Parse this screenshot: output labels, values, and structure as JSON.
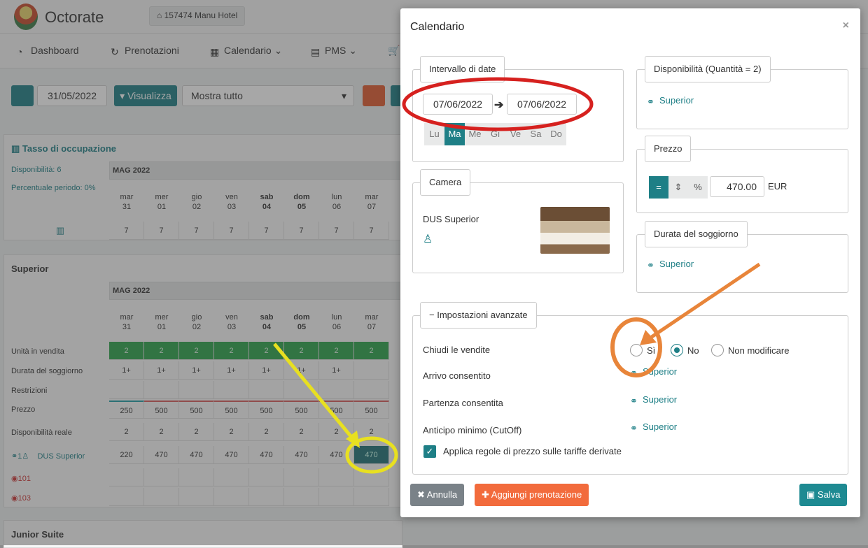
{
  "app": {
    "name": "Octorate",
    "hotel": "157474  Manu Hotel"
  },
  "nav": [
    {
      "label": "Dashboard",
      "icon": "dashboard-icon"
    },
    {
      "label": "Prenotazioni",
      "icon": "bookings-icon"
    },
    {
      "label": "Calendario",
      "icon": "calendar-icon"
    },
    {
      "label": "PMS",
      "icon": "pms-icon"
    }
  ],
  "toolbar": {
    "date": "31/05/2022",
    "visualizza": "Visualizza",
    "filter": "Mostra tutto"
  },
  "occupancy": {
    "title": "Tasso di occupazione",
    "disponibilita": "Disponibilità: 6",
    "percentuale": "Percentuale periodo: 0%",
    "month": "MAG 2022",
    "days": [
      {
        "d": "mar",
        "n": "31"
      },
      {
        "d": "mer",
        "n": "01"
      },
      {
        "d": "gio",
        "n": "02"
      },
      {
        "d": "ven",
        "n": "03"
      },
      {
        "d": "sab",
        "n": "04"
      },
      {
        "d": "dom",
        "n": "05"
      },
      {
        "d": "lun",
        "n": "06"
      },
      {
        "d": "mar",
        "n": "07"
      }
    ],
    "values": [
      "7",
      "7",
      "7",
      "7",
      "7",
      "7",
      "7",
      "7"
    ]
  },
  "superior": {
    "title": "Superior",
    "month": "MAG 2022",
    "rows": {
      "unita": {
        "label": "Unità in vendita",
        "values": [
          "2",
          "2",
          "2",
          "2",
          "2",
          "2",
          "2",
          "2"
        ]
      },
      "durata": {
        "label": "Durata del soggiorno",
        "values": [
          "1+",
          "1+",
          "1+",
          "1+",
          "1+",
          "1+",
          "1+",
          ""
        ]
      },
      "restrizioni": {
        "label": "Restrizioni"
      },
      "prezzo": {
        "label": "Prezzo",
        "values": [
          "250",
          "500",
          "500",
          "500",
          "500",
          "500",
          "500",
          "500"
        ]
      },
      "disp": {
        "label": "Disponibilità reale",
        "values": [
          "2",
          "2",
          "2",
          "2",
          "2",
          "2",
          "2",
          "2"
        ]
      },
      "dus": {
        "label": "DUS Superior",
        "prefix": "1",
        "values": [
          "220",
          "470",
          "470",
          "470",
          "470",
          "470",
          "470",
          "470"
        ]
      }
    },
    "rooms": [
      "101",
      "103"
    ]
  },
  "junior": {
    "title": "Junior Suite"
  },
  "modal": {
    "title": "Calendario",
    "close": "×",
    "intervallo": {
      "legend": "Intervallo di date",
      "from": "07/06/2022",
      "to": "07/06/2022",
      "days": [
        "Lu",
        "Ma",
        "Me",
        "Gi",
        "Ve",
        "Sa",
        "Do"
      ]
    },
    "disponibilita": {
      "legend": "Disponibilità (Quantità = 2)",
      "link": "Superior"
    },
    "prezzo": {
      "legend": "Prezzo",
      "value": "470.00",
      "currency": "EUR",
      "eq": "=",
      "updown": "⇕",
      "pct": "%"
    },
    "camera": {
      "legend": "Camera",
      "name": "DUS Superior"
    },
    "durata": {
      "legend": "Durata del soggiorno",
      "link": "Superior"
    },
    "avanzate": {
      "legend": "Impostazioni avanzate",
      "chiudi": "Chiudi le vendite",
      "opt_si": "Sì",
      "opt_no": "No",
      "opt_nonmod": "Non modificare",
      "arrivo": "Arrivo consentito",
      "arrivo_link": "Superior",
      "partenza": "Partenza consentita",
      "partenza_link": "Superior",
      "anticipo": "Anticipo minimo (CutOff)",
      "anticipo_link": "Superior",
      "applica": "Applica regole di prezzo sulle tariffe derivate"
    },
    "buttons": {
      "annulla": "Annulla",
      "aggiungi": "Aggiungi prenotazione",
      "salva": "Salva"
    }
  },
  "colors": {
    "teal": "#1e7f86",
    "orange": "#e05a2f",
    "green": "#2aa34a",
    "annotation_red": "#d6211f",
    "annotation_yellow": "#e8e020",
    "annotation_orange": "#e8853a"
  }
}
